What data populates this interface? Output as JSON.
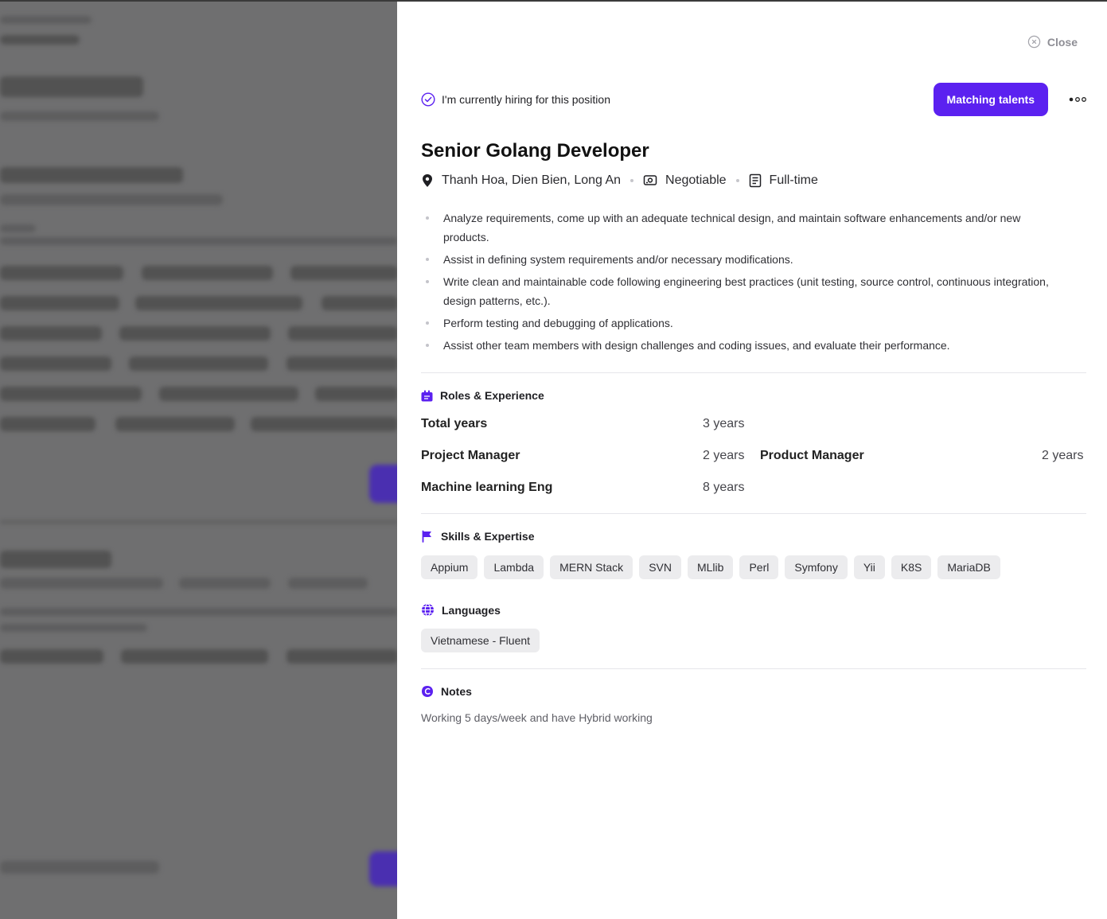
{
  "drawer": {
    "close_label": "Close",
    "hiring_text": "I'm currently hiring for this position",
    "match_button": "Matching talents",
    "job_title": "Senior Golang Developer",
    "location": "Thanh Hoa, Dien Bien, Long An",
    "salary": "Negotiable",
    "job_type": "Full-time",
    "description": [
      "Analyze requirements, come up with an adequate technical design, and maintain software enhancements and/or new products.",
      "Assist in defining system requirements and/or necessary modifications.",
      "Write clean and maintainable code following engineering best practices (unit testing, source control, continuous integration, design patterns, etc.).",
      "Perform testing and debugging of applications.",
      "Assist other team members with design challenges and coding issues, and evaluate their performance."
    ],
    "roles": {
      "heading": "Roles & Experience",
      "total_label": "Total years",
      "total_value": "3 years",
      "items": [
        {
          "role": "Project Manager",
          "years": "2 years"
        },
        {
          "role": "Product Manager",
          "years": "2 years"
        },
        {
          "role": "Machine learning Eng",
          "years": "8 years"
        }
      ]
    },
    "skills": {
      "heading": "Skills & Expertise",
      "items": [
        "Appium",
        "Lambda",
        "MERN Stack",
        "SVN",
        "MLlib",
        "Perl",
        "Symfony",
        "Yii",
        "K8S",
        "MariaDB"
      ]
    },
    "languages": {
      "heading": "Languages",
      "items": [
        "Vietnamese - Fluent"
      ]
    },
    "notes": {
      "heading": "Notes",
      "text": "Working 5 days/week and have Hybrid working"
    }
  },
  "colors": {
    "accent": "#5b21f0",
    "overlay": "#6f6f70"
  },
  "icons": {
    "close": "close-circle-icon",
    "hiring": "check-circle-icon",
    "more": "more-dots-icon",
    "location": "location-pin-icon",
    "salary": "money-icon",
    "job_type": "document-icon",
    "roles": "briefcase-icon",
    "skills": "flag-icon",
    "languages": "globe-icon",
    "notes": "note-icon"
  }
}
